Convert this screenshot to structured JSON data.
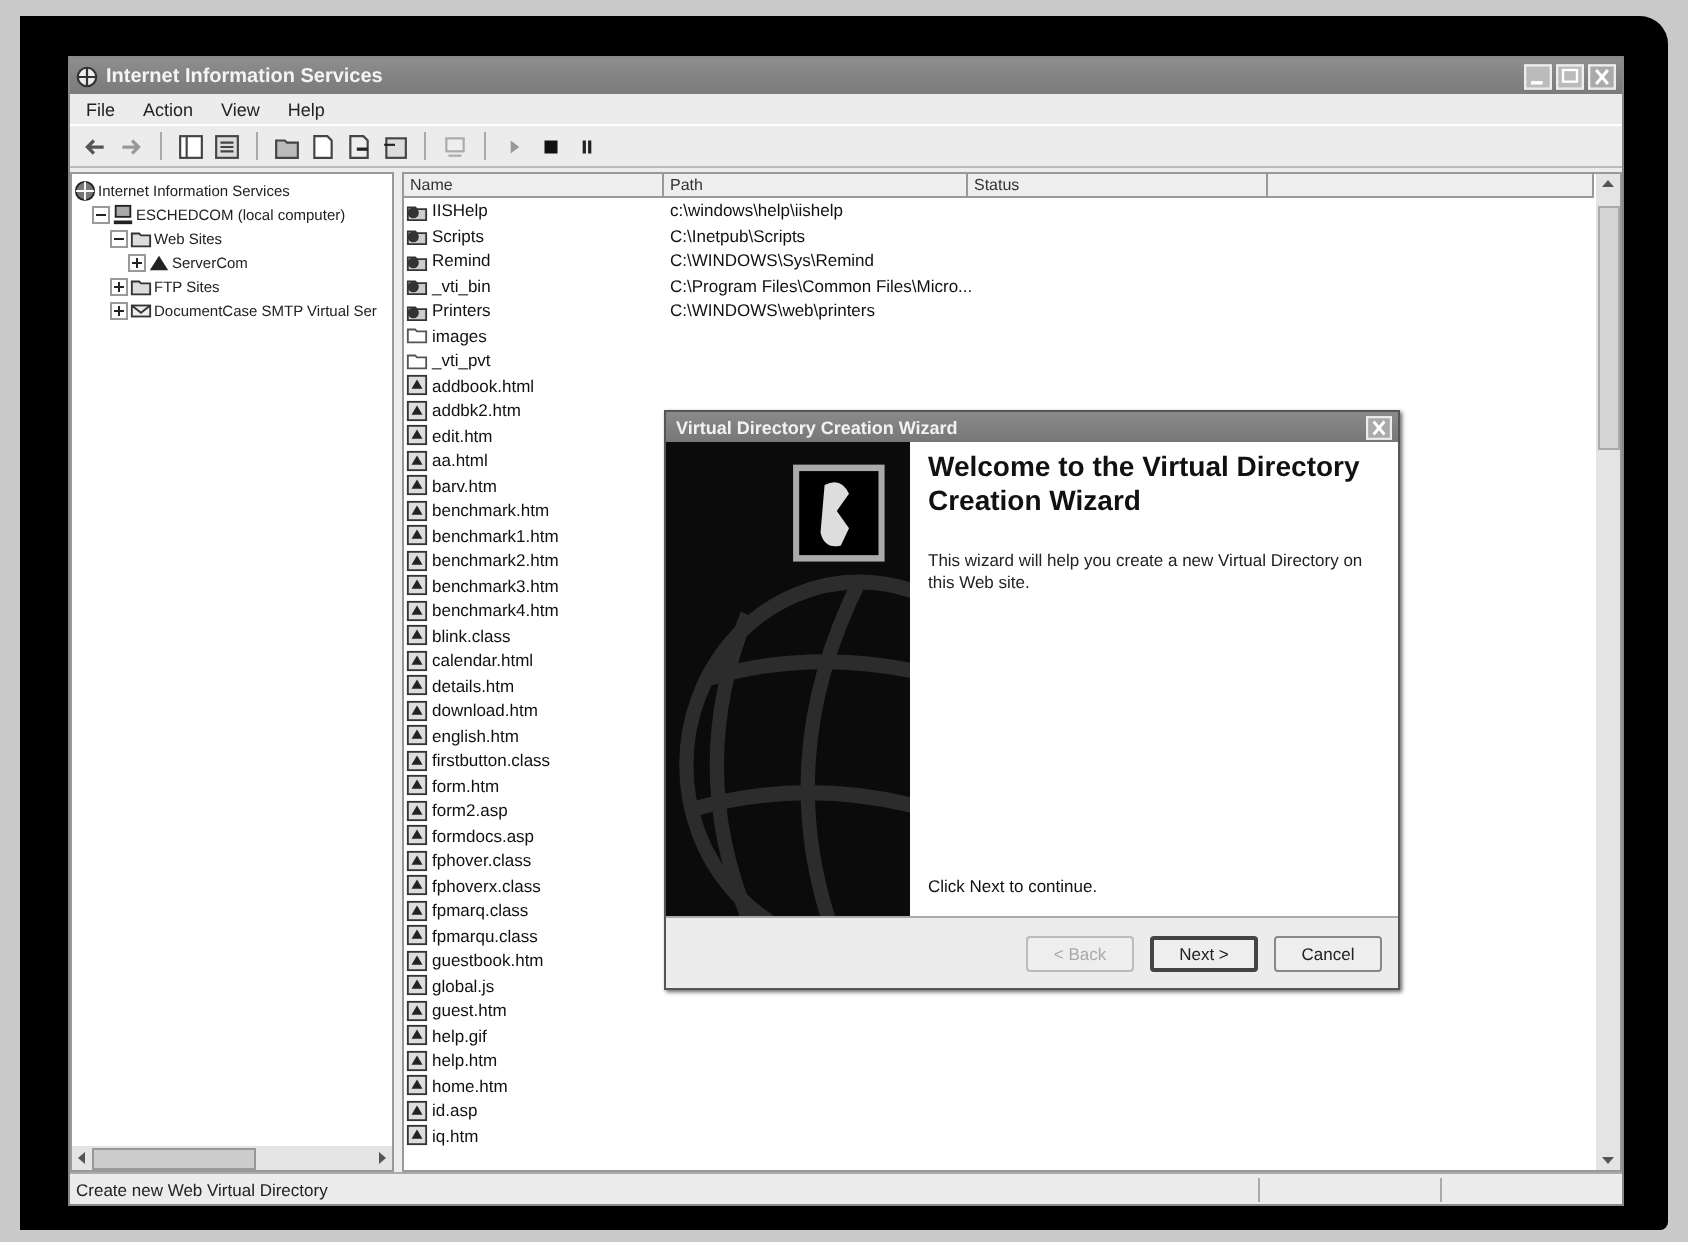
{
  "window": {
    "title": "Internet Information Services"
  },
  "menu": [
    "File",
    "Action",
    "View",
    "Help"
  ],
  "tree": [
    {
      "label": "Internet Information Services",
      "kind": "root",
      "children": [
        {
          "label": "ESCHEDCOM (local computer)",
          "kind": "computer",
          "expanded": true,
          "children": [
            {
              "label": "Web Sites",
              "kind": "folder",
              "expanded": true,
              "children": [
                {
                  "label": "ServerCom",
                  "kind": "site",
                  "expanded": false
                }
              ]
            },
            {
              "label": "FTP Sites",
              "kind": "folder",
              "expanded": false
            },
            {
              "label": "DocumentCase SMTP Virtual Ser",
              "kind": "smtp",
              "expanded": false
            }
          ]
        }
      ]
    }
  ],
  "list": {
    "columns": [
      "Name",
      "Path",
      "Status"
    ],
    "rows": [
      {
        "name": "IISHelp",
        "kind": "vdir",
        "path": "c:\\windows\\help\\iishelp"
      },
      {
        "name": "Scripts",
        "kind": "vdir",
        "path": "C:\\Inetpub\\Scripts"
      },
      {
        "name": "Remind",
        "kind": "vdir",
        "path": "C:\\WINDOWS\\Sys\\Remind"
      },
      {
        "name": "_vti_bin",
        "kind": "vdir",
        "path": "C:\\Program Files\\Common Files\\Micro..."
      },
      {
        "name": "Printers",
        "kind": "vdir",
        "path": "C:\\WINDOWS\\web\\printers"
      },
      {
        "name": "images",
        "kind": "folder"
      },
      {
        "name": "_vti_pvt",
        "kind": "folder"
      },
      {
        "name": "addbook.html",
        "kind": "file"
      },
      {
        "name": "addbk2.htm",
        "kind": "file"
      },
      {
        "name": "edit.htm",
        "kind": "file"
      },
      {
        "name": "aa.html",
        "kind": "file"
      },
      {
        "name": "barv.htm",
        "kind": "file"
      },
      {
        "name": "benchmark.htm",
        "kind": "file"
      },
      {
        "name": "benchmark1.htm",
        "kind": "file"
      },
      {
        "name": "benchmark2.htm",
        "kind": "file"
      },
      {
        "name": "benchmark3.htm",
        "kind": "file"
      },
      {
        "name": "benchmark4.htm",
        "kind": "file"
      },
      {
        "name": "blink.class",
        "kind": "file"
      },
      {
        "name": "calendar.html",
        "kind": "file"
      },
      {
        "name": "details.htm",
        "kind": "file"
      },
      {
        "name": "download.htm",
        "kind": "file"
      },
      {
        "name": "english.htm",
        "kind": "file"
      },
      {
        "name": "firstbutton.class",
        "kind": "file"
      },
      {
        "name": "form.htm",
        "kind": "file"
      },
      {
        "name": "form2.asp",
        "kind": "file"
      },
      {
        "name": "formdocs.asp",
        "kind": "file"
      },
      {
        "name": "fphover.class",
        "kind": "file"
      },
      {
        "name": "fphoverx.class",
        "kind": "file"
      },
      {
        "name": "fpmarq.class",
        "kind": "file"
      },
      {
        "name": "fpmarqu.class",
        "kind": "file"
      },
      {
        "name": "guestbook.htm",
        "kind": "file"
      },
      {
        "name": "global.js",
        "kind": "file"
      },
      {
        "name": "guest.htm",
        "kind": "file"
      },
      {
        "name": "help.gif",
        "kind": "file"
      },
      {
        "name": "help.htm",
        "kind": "file"
      },
      {
        "name": "home.htm",
        "kind": "file"
      },
      {
        "name": "id.asp",
        "kind": "file"
      },
      {
        "name": "iq.htm",
        "kind": "file"
      }
    ]
  },
  "wizard": {
    "title": "Virtual Directory Creation Wizard",
    "heading": "Welcome to the Virtual Directory Creation Wizard",
    "body": "This wizard will help you create a new Virtual Directory on this Web site.",
    "note": "Click Next to continue.",
    "buttons": [
      {
        "label": "< Back",
        "disabled": true,
        "default": false
      },
      {
        "label": "Next >",
        "disabled": false,
        "default": true
      },
      {
        "label": "Cancel",
        "disabled": false,
        "default": false
      }
    ]
  },
  "status_bar": {
    "text": "Create new Web Virtual Directory"
  }
}
